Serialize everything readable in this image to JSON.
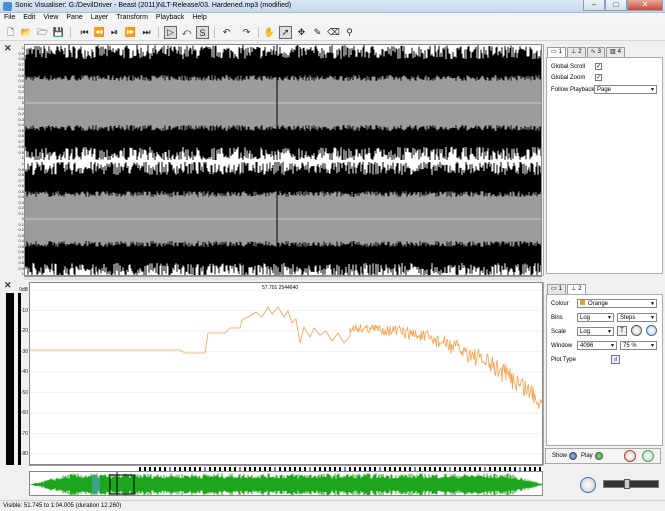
{
  "window": {
    "title": "Sonic Visualiser: G:/DevilDriver - Beast (2011)NLT-Release/03. Hardened.mp3 (modified)"
  },
  "menu": [
    "File",
    "Edit",
    "View",
    "Pane",
    "Layer",
    "Transform",
    "Playback",
    "Help"
  ],
  "waveform_pane": {
    "left_ticks": [
      "1",
      "0.9",
      "0.8",
      "0.7",
      "0.6",
      "0.5",
      "0.4",
      "0.3",
      "0.2",
      "0.1",
      "0",
      "0.1",
      "0.2",
      "0.3",
      "0.4",
      "0.5",
      "0.6",
      "0.7",
      "0.8",
      "0.9",
      "1"
    ],
    "tabs": [
      "1",
      "2",
      "3",
      "4"
    ],
    "properties": {
      "global_scroll_label": "Global Scroll",
      "global_zoom_label": "Global Zoom",
      "follow_playback_label": "Follow Playback",
      "follow_playback_value": "Page",
      "global_scroll_checked": "✓",
      "global_zoom_checked": "✓"
    }
  },
  "spectrum_pane": {
    "readout": "57.701   2544640",
    "db_labels": [
      "0dB",
      "-10",
      "-20",
      "-30",
      "-40",
      "-50",
      "-60",
      "-70",
      "-80"
    ],
    "tabs": [
      "1",
      "2"
    ],
    "properties": {
      "colour_label": "Colour",
      "colour_value": "Orange",
      "bins_label": "Bins",
      "bins_value": "Log",
      "bins_mode": "Steps",
      "scale_label": "Scale",
      "scale_value": "Log",
      "window_label": "Window",
      "window_value": "4096",
      "window_overlap": "75 %",
      "plot_type_label": "Plot Type"
    },
    "show_label": "Show",
    "play_label": "Play"
  },
  "status": {
    "text": "Visible: 51.745 to 1:04.005 (duration 12.260)"
  },
  "colors": {
    "spectrum_line": "#f5a04a",
    "overview_green": "#1ea51e",
    "wave_black": "#000000",
    "wave_grey": "#9c9c9c"
  }
}
